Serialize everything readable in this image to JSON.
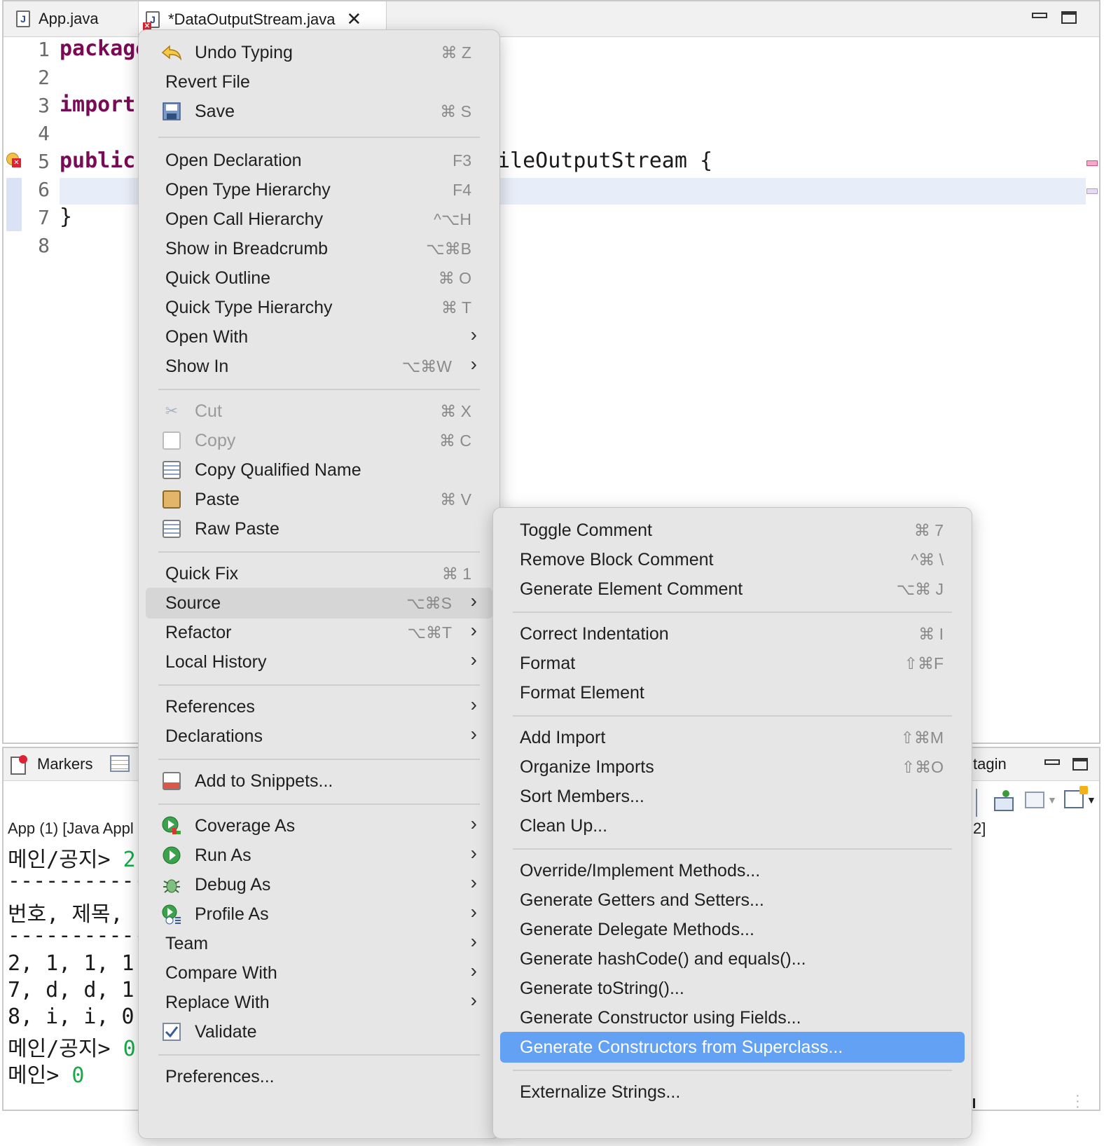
{
  "tabs": [
    {
      "label": "App.java"
    },
    {
      "label": "*DataOutputStream.java"
    }
  ],
  "editor": {
    "line_numbers": [
      "1",
      "2",
      "3",
      "4",
      "5",
      "6",
      "7",
      "8"
    ],
    "lines": {
      "l1": "package",
      "l3": "import",
      "l5_kw": "public",
      "l5_rest": "ileOutputStream {",
      "l7": "}"
    }
  },
  "bottom_panel": {
    "tab_markers": "Markers",
    "tab_right": "tagin",
    "app_label": "App (1) [Java Appl",
    "right_count": "2]",
    "console": [
      {
        "text": "메인/공지> ",
        "input": "2"
      },
      {
        "text": "------------",
        "input": ""
      },
      {
        "text": "번호, 제목,",
        "input": ""
      },
      {
        "text": "------------",
        "input": ""
      },
      {
        "text": "2, 1, 1, 1,",
        "input": ""
      },
      {
        "text": "7, d, d, 1,",
        "input": ""
      },
      {
        "text": "8, i, i, 0,",
        "input": ""
      },
      {
        "text": "메인/공지> ",
        "input": "0"
      },
      {
        "text": "메인> ",
        "input": "0"
      }
    ]
  },
  "context_menu": {
    "items": [
      {
        "label": "Undo Typing",
        "shortcut": "⌘ Z",
        "icon": "undo-icon"
      },
      {
        "label": "Revert File",
        "shortcut": ""
      },
      {
        "label": "Save",
        "shortcut": "⌘ S",
        "icon": "save-icon"
      },
      {
        "label": "Open Declaration",
        "shortcut": "F3"
      },
      {
        "label": "Open Type Hierarchy",
        "shortcut": "F4"
      },
      {
        "label": "Open Call Hierarchy",
        "shortcut": "^⌥H"
      },
      {
        "label": "Show in Breadcrumb",
        "shortcut": "⌥⌘B"
      },
      {
        "label": "Quick Outline",
        "shortcut": "⌘ O"
      },
      {
        "label": "Quick Type Hierarchy",
        "shortcut": "⌘ T"
      },
      {
        "label": "Open With",
        "shortcut": ""
      },
      {
        "label": "Show In",
        "shortcut": "⌥⌘W"
      },
      {
        "label": "Cut",
        "shortcut": "⌘ X",
        "icon": "scissors-icon"
      },
      {
        "label": "Copy",
        "shortcut": "⌘ C",
        "icon": "copy-icon"
      },
      {
        "label": "Copy Qualified Name",
        "shortcut": "",
        "icon": "copy-qualified-icon"
      },
      {
        "label": "Paste",
        "shortcut": "⌘ V",
        "icon": "paste-icon"
      },
      {
        "label": "Raw Paste",
        "shortcut": "",
        "icon": "raw-paste-icon"
      },
      {
        "label": "Quick Fix",
        "shortcut": "⌘ 1"
      },
      {
        "label": "Source",
        "shortcut": "⌥⌘S"
      },
      {
        "label": "Refactor",
        "shortcut": "⌥⌘T"
      },
      {
        "label": "Local History",
        "shortcut": ""
      },
      {
        "label": "References",
        "shortcut": ""
      },
      {
        "label": "Declarations",
        "shortcut": ""
      },
      {
        "label": "Add to Snippets...",
        "shortcut": "",
        "icon": "snippet-icon"
      },
      {
        "label": "Coverage As",
        "shortcut": "",
        "icon": "coverage-icon"
      },
      {
        "label": "Run As",
        "shortcut": "",
        "icon": "run-icon"
      },
      {
        "label": "Debug As",
        "shortcut": "",
        "icon": "bug-icon"
      },
      {
        "label": "Profile As",
        "shortcut": "",
        "icon": "profile-icon"
      },
      {
        "label": "Team",
        "shortcut": ""
      },
      {
        "label": "Compare With",
        "shortcut": ""
      },
      {
        "label": "Replace With",
        "shortcut": ""
      },
      {
        "label": "Validate",
        "shortcut": "",
        "icon": "checkbox-icon"
      },
      {
        "label": "Preferences...",
        "shortcut": ""
      }
    ]
  },
  "source_submenu": {
    "items": [
      {
        "label": "Toggle Comment",
        "shortcut": "⌘ 7"
      },
      {
        "label": "Remove Block Comment",
        "shortcut": "^⌘ \\"
      },
      {
        "label": "Generate Element Comment",
        "shortcut": "⌥⌘ J"
      },
      {
        "label": "Correct Indentation",
        "shortcut": "⌘ I"
      },
      {
        "label": "Format",
        "shortcut": "⇧⌘F"
      },
      {
        "label": "Format Element",
        "shortcut": ""
      },
      {
        "label": "Add Import",
        "shortcut": "⇧⌘M"
      },
      {
        "label": "Organize Imports",
        "shortcut": "⇧⌘O"
      },
      {
        "label": "Sort Members...",
        "shortcut": ""
      },
      {
        "label": "Clean Up...",
        "shortcut": ""
      },
      {
        "label": "Override/Implement Methods...",
        "shortcut": ""
      },
      {
        "label": "Generate Getters and Setters...",
        "shortcut": ""
      },
      {
        "label": "Generate Delegate Methods...",
        "shortcut": ""
      },
      {
        "label": "Generate hashCode() and equals()...",
        "shortcut": ""
      },
      {
        "label": "Generate toString()...",
        "shortcut": ""
      },
      {
        "label": "Generate Constructor using Fields...",
        "shortcut": ""
      },
      {
        "label": "Generate Constructors from Superclass...",
        "shortcut": ""
      },
      {
        "label": "Externalize Strings...",
        "shortcut": ""
      }
    ]
  },
  "colors": {
    "keyword": "#7a0a55",
    "selection": "#63a1f4",
    "menu_bg": "#e6e6e6",
    "current_line": "#e8eef9",
    "console_input": "#1aa84a"
  }
}
